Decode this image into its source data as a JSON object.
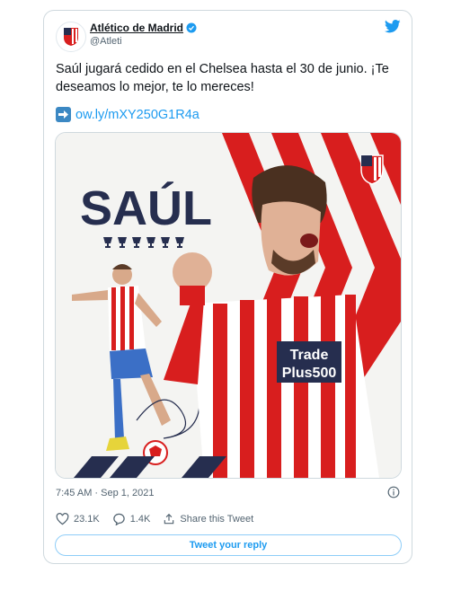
{
  "tweet": {
    "display_name": "Atlético de Madrid",
    "handle": "@Atleti",
    "text": "Saúl jugará cedido en el Chelsea hasta el 30 de junio. ¡Te deseamos lo mejor, te lo mereces!",
    "link": "ow.ly/mXY250G1R4a",
    "timestamp": "7:45 AM · Sep 1, 2021",
    "likes": "23.1K",
    "replies": "1.4K",
    "share_label": "Share this Tweet",
    "reply_button_label": "Tweet your reply"
  },
  "media": {
    "headline": "SAÚL",
    "sponsor_line1": "Trade",
    "sponsor_line2": "Plus500"
  },
  "colors": {
    "accent": "#1d9bf0",
    "text": "#0f1419",
    "muted": "#536471",
    "atleti_red": "#d81e1e",
    "atleti_navy": "#262e4f"
  },
  "icons": [
    "verified-badge-icon",
    "twitter-bird-icon",
    "right-arrow-icon",
    "info-icon",
    "heart-icon",
    "reply-icon",
    "share-icon"
  ]
}
